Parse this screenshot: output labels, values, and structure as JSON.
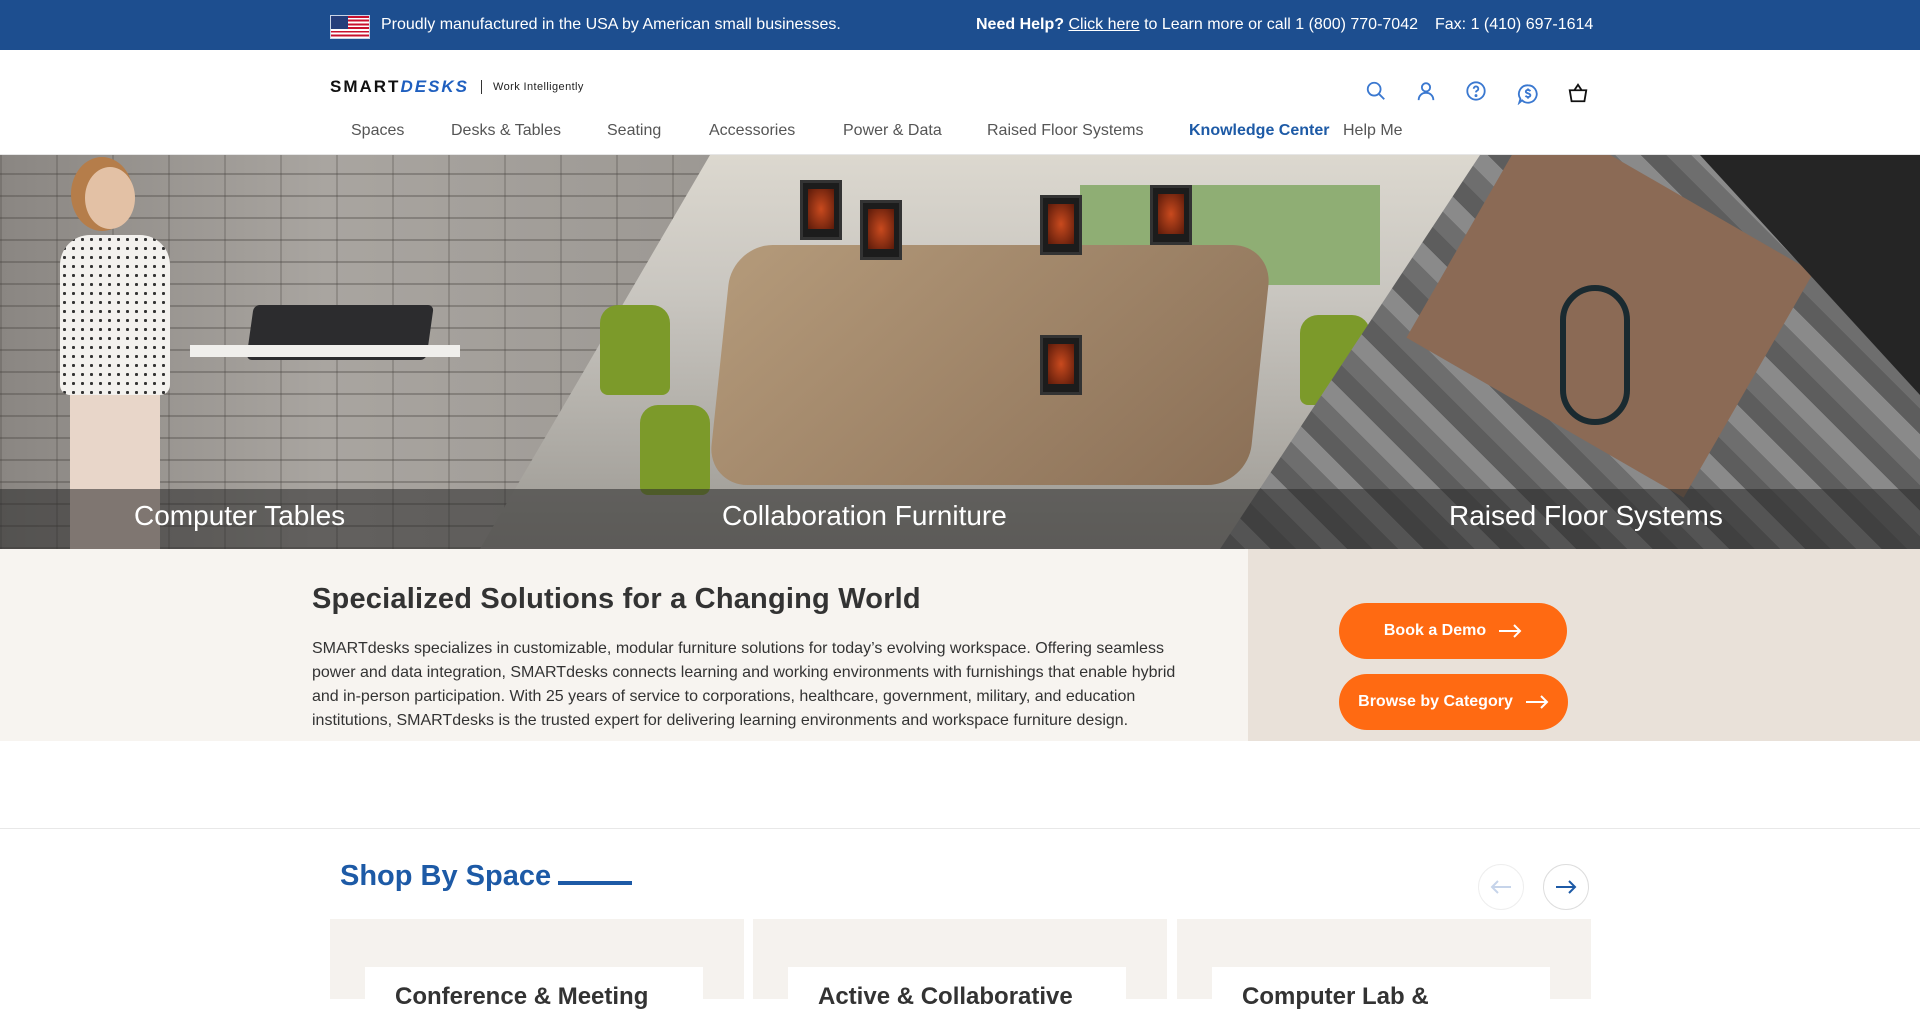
{
  "topbar": {
    "message": "Proudly manufactured in the USA by American small businesses.",
    "help_label": "Need Help?",
    "help_link": "Click here",
    "help_rest": "to Learn more or call 1 (800) 770-7042",
    "fax": "Fax: 1 (410) 697-1614"
  },
  "header": {
    "logo_part1": "SMART",
    "logo_part2": "DESKS",
    "tagline": "Work Intelligently",
    "icons": [
      "search-icon",
      "account-icon",
      "help-icon",
      "chat-icon",
      "cart-icon"
    ]
  },
  "nav": {
    "items": [
      "Spaces",
      "Desks & Tables",
      "Seating",
      "Accessories",
      "Power & Data",
      "Raised Floor Systems",
      "Knowledge Center",
      "Help Me"
    ],
    "active": "Knowledge Center"
  },
  "hero": {
    "captions": [
      "Computer Tables",
      "Collaboration Furniture",
      "Raised Floor Systems"
    ]
  },
  "intro": {
    "title": "Specialized Solutions for a Changing World",
    "body": "SMARTdesks specializes in customizable, modular furniture solutions for today’s evolving workspace. Offering seamless power and data integration, SMARTdesks connects learning and working environments with furnishings that enable hybrid and in-person participation. With 25 years of service to corporations, healthcare, government, military, and education institutions, SMARTdesks is the trusted expert for delivering learning environments and workspace furniture design."
  },
  "cta": {
    "book_demo": "Book a Demo",
    "browse": "Browse by Category"
  },
  "shop": {
    "title": "Shop By Space",
    "cards": [
      "Conference & Meeting",
      "Active & Collaborative",
      "Computer Lab &"
    ]
  },
  "colors": {
    "topbar": "#1d4e8f",
    "accent": "#ff6a12",
    "brand_blue": "#1d5aa6"
  }
}
